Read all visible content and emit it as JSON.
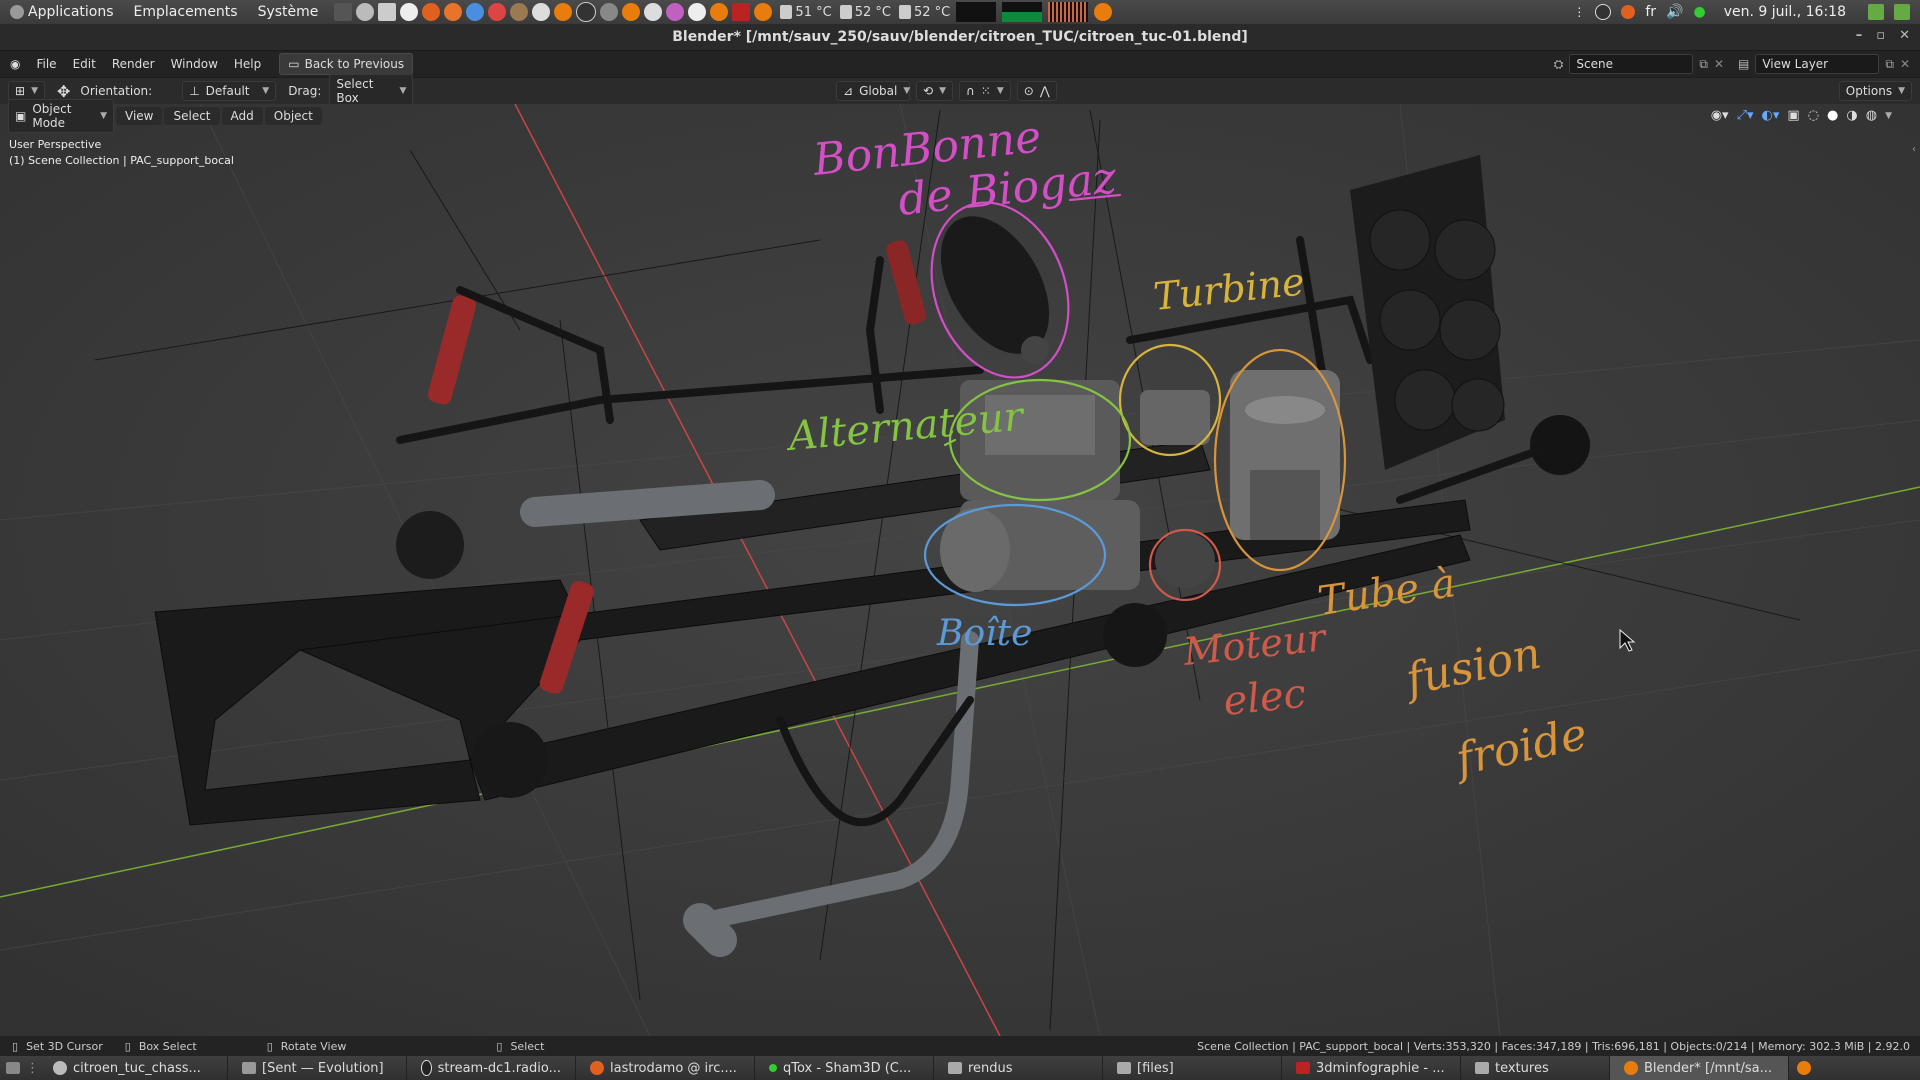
{
  "os_panel": {
    "applications": "Applications",
    "places": "Emplacements",
    "system": "Système",
    "temps": [
      "51 °C",
      "52 °C",
      "52 °C"
    ],
    "language": "fr",
    "clock": "ven. 9 juil., 16:18"
  },
  "window": {
    "title": "Blender* [/mnt/sauv_250/sauv/blender/citroen_TUC/citroen_tuc-01.blend]"
  },
  "blender_menu": {
    "file": "File",
    "edit": "Edit",
    "render": "Render",
    "window": "Window",
    "help": "Help",
    "back": "Back to Previous",
    "scene_label": "Scene",
    "view_layer": "View Layer"
  },
  "toolbar": {
    "orientation_label": "Orientation:",
    "orientation_value": "Default",
    "drag_label": "Drag:",
    "drag_value": "Select Box",
    "transform": "Global",
    "options": "Options"
  },
  "viewport_header": {
    "mode": "Object Mode",
    "view": "View",
    "select": "Select",
    "add": "Add",
    "object": "Object"
  },
  "overlay": {
    "perspective": "User Perspective",
    "collection": "(1) Scene Collection | PAC_support_bocal"
  },
  "annotations": {
    "bonbonne": [
      "BonBonne",
      "de Biogaz"
    ],
    "turbine": "Turbine",
    "alternator": "Alternateur",
    "gearbox": "Boîte",
    "motor": [
      "Moteur",
      "elec"
    ],
    "tube": [
      "Tube à",
      "fusion",
      "froide"
    ]
  },
  "colors": {
    "pink": "#d24fc6",
    "yellow": "#d8b43a",
    "green": "#84c442",
    "blue": "#5b9ad8",
    "red": "#d05a4a",
    "orange": "#d9953a"
  },
  "statusbar": {
    "cursor": "Set 3D Cursor",
    "box": "Box Select",
    "rotate": "Rotate View",
    "select": "Select",
    "stats": "Scene Collection | PAC_support_bocal | Verts:353,320 | Faces:347,189 | Tris:696,181 | Objects:0/214 | Memory: 302.3 MiB | 2.92.0"
  },
  "taskbar": [
    "citroen_tuc_chass...",
    "[Sent — Evolution]",
    "stream-dc1.radio...",
    "lastrodamo @ irc....",
    "qTox - Sham3D (C...",
    "rendus",
    "[files]",
    "3dminfographie - ...",
    "textures",
    "Blender* [/mnt/sa..."
  ]
}
